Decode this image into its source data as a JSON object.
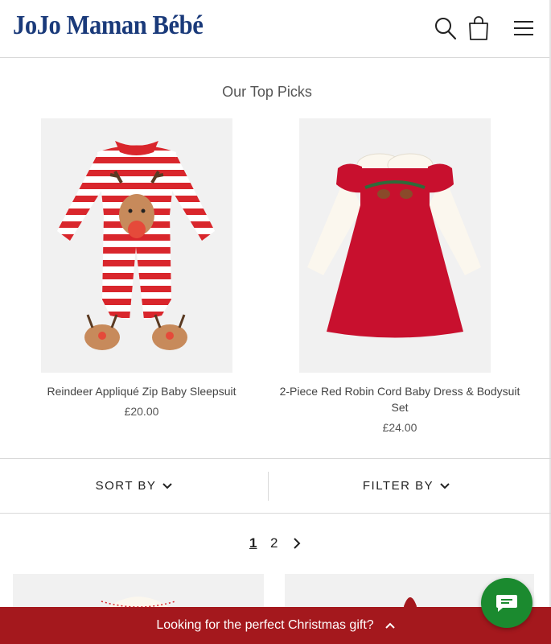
{
  "header": {
    "logo_text": "JoJo Maman Bébé",
    "icons": [
      "search-icon",
      "shopping-bag-icon",
      "hamburger-menu-icon"
    ]
  },
  "top_picks": {
    "title": "Our Top Picks",
    "products": [
      {
        "name": "Reindeer Appliqué Zip Baby Sleepsuit",
        "price": "£20.00"
      },
      {
        "name": "2-Piece Red Robin Cord Baby Dress & Bodysuit Set",
        "price": "£24.00"
      }
    ]
  },
  "toolbar": {
    "sort_label": "SORT BY",
    "filter_label": "FILTER BY"
  },
  "pagination": {
    "current": "1",
    "next_page": "2"
  },
  "promo_bar": {
    "text": "Looking for the perfect Christmas gift?"
  },
  "colors": {
    "brand_blue": "#1a3a7a",
    "promo_red": "#a4181d",
    "chat_green": "#1b8a2f"
  }
}
